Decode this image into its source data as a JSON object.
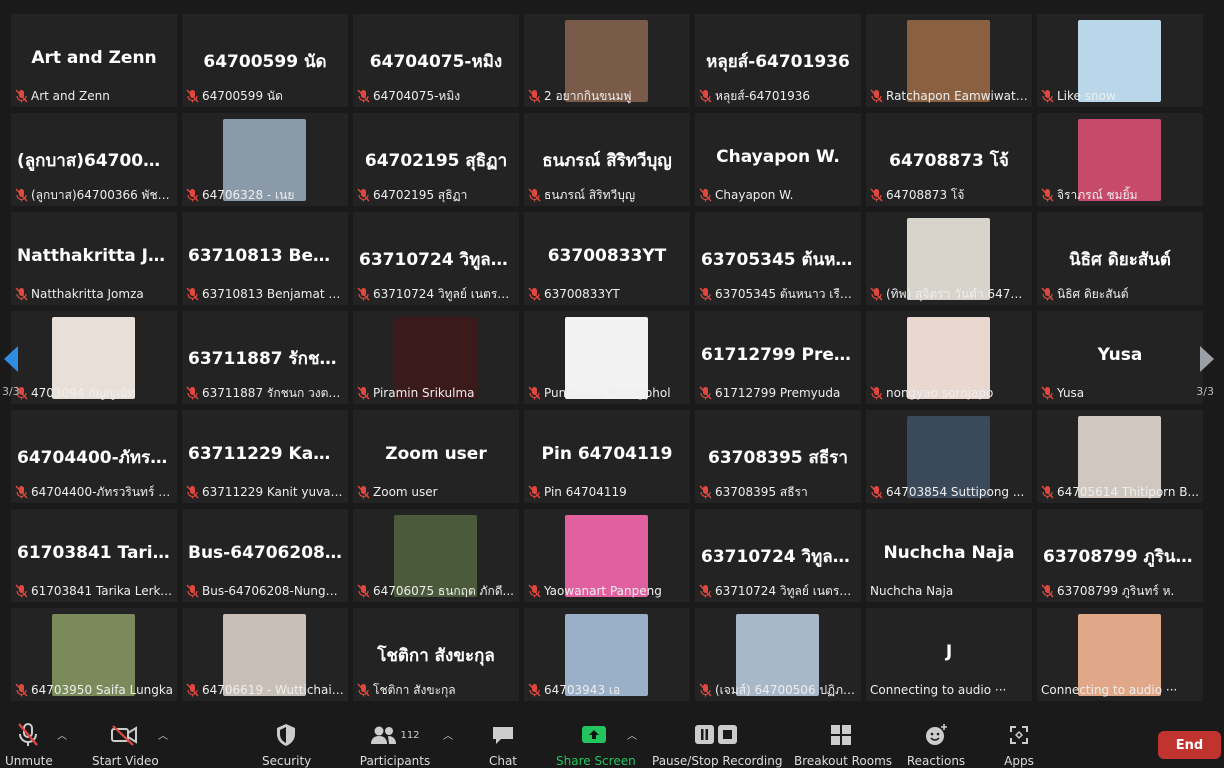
{
  "tiles": [
    {
      "big": "Art and Zenn",
      "label": "Art and Zenn"
    },
    {
      "big": "64700599 นัด",
      "label": "64700599 นัด"
    },
    {
      "big": "64704075-หมิง",
      "label": "64704075-หมิง"
    },
    {
      "photo": "#7a5a48",
      "label": "2 อยากกินขนมพู่"
    },
    {
      "big": "หลุยส์-64701936",
      "label": "หลุยส์-64701936"
    },
    {
      "photo": "#8a6040",
      "label": "Ratchapon Eamwiwat_..."
    },
    {
      "photo": "#b9d7e8",
      "label": "Like snow"
    },
    {
      "big": "(ลูกบาส)647003...",
      "label": "(ลูกบาส)64700366 พัชร..."
    },
    {
      "photo": "#8a9aa8",
      "label": "64706328 - เนย"
    },
    {
      "big": "64702195 สุธิฏา",
      "label": "64702195 สุธิฏา"
    },
    {
      "big": "ธนภรณ์ สิริทวีบุญ",
      "label": "ธนภรณ์ สิริทวีบุญ"
    },
    {
      "big": "Chayapon W.",
      "label": "Chayapon W."
    },
    {
      "big": "64708873 โจ้",
      "label": "64708873 โจ้"
    },
    {
      "photo": "#c84a6a",
      "label": "จิราภรณ์ ชมยิ้ม"
    },
    {
      "big": "Natthakritta Jo...",
      "label": "Natthakritta Jomza"
    },
    {
      "big": "63710813 Benja...",
      "label": "63710813 Benjamat P..."
    },
    {
      "big": "63710724 วิทูลย์...",
      "label": "63710724 วิทูลย์ เนตรโส..."
    },
    {
      "big": "63700833YT",
      "label": "63700833YT"
    },
    {
      "big": "63705345 ต้นหน...",
      "label": "63705345 ต้นหนาว เรือง..."
    },
    {
      "photo": "#d8d4cc",
      "label": "(ทิพ) สุจิตรา วันดำ 6470..."
    },
    {
      "big": "นิธิศ ดิยะสันต์",
      "label": "นิธิศ ดิยะสันต์"
    },
    {
      "photo": "#e8e0d8",
      "label": "4703094 กัญญณัท"
    },
    {
      "big": "63711887 รักชน...",
      "label": "63711887 รักชนก วงตา..."
    },
    {
      "photo": "#3a1a1a",
      "label": "Piramin Srikulma"
    },
    {
      "photo": "#f2f2f2",
      "label": "Punchanit Phangphol"
    },
    {
      "big": "61712799 Prem...",
      "label": "61712799 Premyuda"
    },
    {
      "photo": "#e8d8d0",
      "label": "nongyao sornjapo"
    },
    {
      "big": "Yusa",
      "label": "Yusa"
    },
    {
      "big": "64704400-ภัทรว...",
      "label": "64704400-ภัทรวรินทร์ ต..."
    },
    {
      "big": "63711229 Kanit...",
      "label": "63711229 Kanit yuvak..."
    },
    {
      "big": "Zoom user",
      "label": "Zoom user"
    },
    {
      "big": "Pin 64704119",
      "label": "Pin 64704119"
    },
    {
      "big": "63708395 สธีรา",
      "label": "63708395 สธีรา"
    },
    {
      "photo": "#3a4a5a",
      "label": "64703854 Suttipong ..."
    },
    {
      "photo": "#d0c8c0",
      "label": "64705614 Thitiporn B..."
    },
    {
      "big": "61703841 Tarik...",
      "label": "61703841 Tarika Lerku..."
    },
    {
      "big": "Bus-64706208-...",
      "label": "Bus-64706208-Nungn..."
    },
    {
      "photo": "#4a5a3a",
      "label": "64706075 ธนกฤต ภักดี..."
    },
    {
      "photo": "#e060a0",
      "label": "Yaowanart Panpeng"
    },
    {
      "big": "63710724 วิทูลย์...",
      "label": "63710724 วิทูลย์ เนตรโส..."
    },
    {
      "big": "Nuchcha Naja",
      "label": "Nuchcha Naja",
      "nomic": true
    },
    {
      "big": "63708799 ภูรินท...",
      "label": "63708799 ภูรินทร์ ห."
    },
    {
      "photo": "#7a8a5a",
      "label": "64703950 Saifa Lungka"
    },
    {
      "photo": "#c8c0b8",
      "label": "64706619 - Wuttichai K."
    },
    {
      "big": "โชติกา สังขะกุล",
      "label": "โชติกา สังขะกุล"
    },
    {
      "photo": "#9ab0c8",
      "label": "64703943 เอ"
    },
    {
      "photo": "#a8b8c8",
      "label": "(เจมส์) 64700506 ปฏิภา..."
    },
    {
      "big": "J",
      "label": "Connecting to audio ···",
      "nomic": true
    },
    {
      "photo": "#e0a888",
      "label": "Connecting to audio ···",
      "nomic": true
    }
  ],
  "nav": {
    "page_left": "3/3",
    "page_right": "3/3"
  },
  "toolbar": {
    "unmute": "Unmute",
    "start_video": "Start Video",
    "security": "Security",
    "participants": "Participants",
    "participant_count": "112",
    "chat": "Chat",
    "share_screen": "Share Screen",
    "recording": "Pause/Stop Recording",
    "breakout": "Breakout Rooms",
    "reactions": "Reactions",
    "apps": "Apps",
    "end": "End"
  },
  "colors": {
    "mic_off": "#e0483f",
    "share_green": "#22c55e",
    "end_red": "#c0332f"
  }
}
